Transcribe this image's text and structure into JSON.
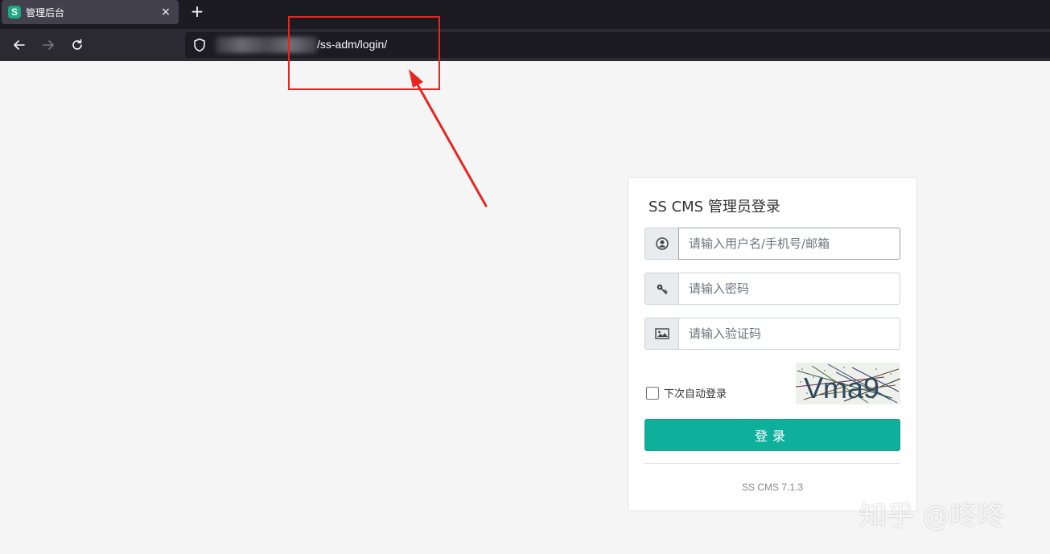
{
  "browser": {
    "tab": {
      "title": "管理后台",
      "favicon_letter": "S",
      "close": "×"
    },
    "new_tab": "+",
    "url_path": "/ss-adm/login/"
  },
  "login": {
    "title": "SS CMS 管理员登录",
    "username_placeholder": "请输入用户名/手机号/邮箱",
    "password_placeholder": "请输入密码",
    "captcha_placeholder": "请输入验证码",
    "captcha_text": "Vma9",
    "remember_label": "下次自动登录",
    "submit_label": "登录",
    "version": "SS CMS 7.1.3"
  },
  "watermark": "知乎 @咚咚",
  "colors": {
    "accent": "#0fb09b",
    "annotation": "#e8261f",
    "chrome_dark": "#1c1b22"
  }
}
